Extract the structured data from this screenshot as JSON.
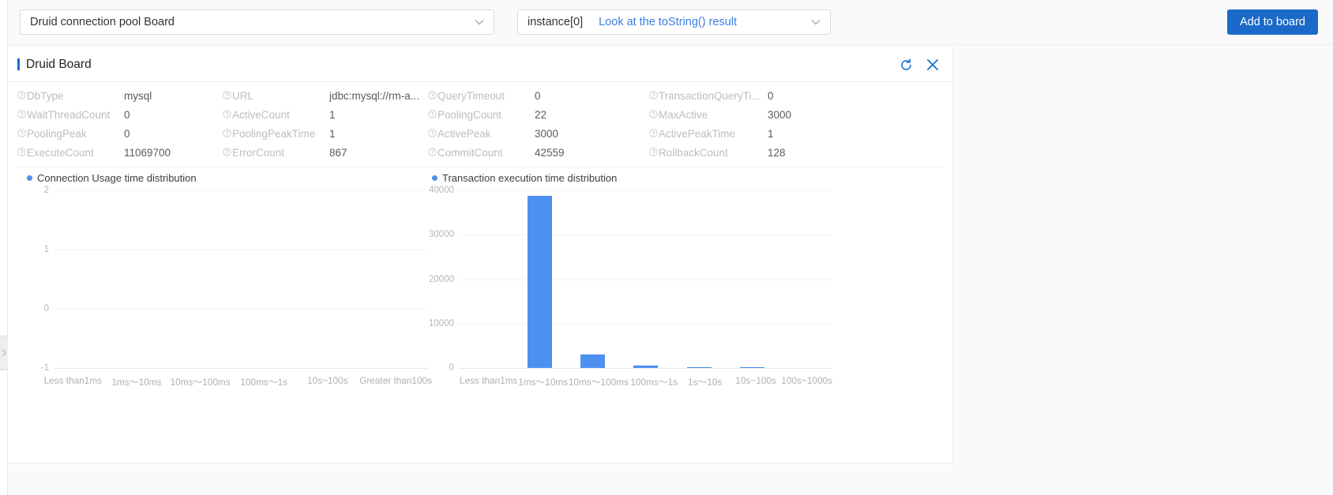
{
  "toolbar": {
    "board_select": {
      "value": "Druid connection pool Board",
      "icon": "chevron-down-icon"
    },
    "instance_select": {
      "value": "instance[0]",
      "link_text": "Look at the toString() result",
      "icon": "chevron-down-icon"
    },
    "add_to_board_label": "Add to board"
  },
  "card": {
    "title": "Druid Board",
    "refresh_icon": "refresh-icon",
    "close_icon": "close-icon"
  },
  "metrics": [
    {
      "label": "DbType",
      "value": "mysql"
    },
    {
      "label": "URL",
      "value": "jdbc:mysql://rm-a..."
    },
    {
      "label": "QueryTimeout",
      "value": "0"
    },
    {
      "label": "TransactionQueryTi...",
      "value": "0"
    },
    {
      "label": "WaitThreadCount",
      "value": "0"
    },
    {
      "label": "ActiveCount",
      "value": "1"
    },
    {
      "label": "PoolingCount",
      "value": "22"
    },
    {
      "label": "MaxActive",
      "value": "3000"
    },
    {
      "label": "PoolingPeak",
      "value": "0"
    },
    {
      "label": "PoolingPeakTime",
      "value": "1"
    },
    {
      "label": "ActivePeak",
      "value": "3000"
    },
    {
      "label": "ActivePeakTime",
      "value": "1"
    },
    {
      "label": "ExecuteCount",
      "value": "11069700"
    },
    {
      "label": "ErrorCount",
      "value": "867"
    },
    {
      "label": "CommitCount",
      "value": "42559"
    },
    {
      "label": "RollbackCount",
      "value": "128"
    }
  ],
  "colors": {
    "accent": "#1b6ac9",
    "bar": "#4d90f0",
    "link": "#3b7fe0",
    "label_gray": "#bdbdbd"
  },
  "chart_data": [
    {
      "type": "bar",
      "title": "Connection Usage time distribution",
      "xlabel": "",
      "ylabel": "",
      "categories": [
        "Less than1ms",
        "1ms～10ms",
        "10ms～100ms",
        "100ms～1s",
        "10s~100s",
        "Greater than100s"
      ],
      "values": [
        0,
        0,
        0,
        0,
        0,
        0
      ],
      "yticks": [
        "2",
        "1",
        "0",
        "-1"
      ],
      "ylim": [
        -1,
        2
      ],
      "grid": true,
      "legend": "top-left"
    },
    {
      "type": "bar",
      "title": "Transaction execution time distribution",
      "xlabel": "",
      "ylabel": "",
      "categories": [
        "Less than1ms",
        "1ms～10ms",
        "10ms～100ms",
        "100ms～1s",
        "1s～10s",
        "10s~100s",
        "100s~1000s"
      ],
      "values": [
        0,
        38800,
        3000,
        450,
        250,
        150,
        0
      ],
      "yticks": [
        "40000",
        "30000",
        "20000",
        "10000",
        "0"
      ],
      "ylim": [
        0,
        40000
      ],
      "grid": true,
      "legend": "top-left"
    }
  ]
}
